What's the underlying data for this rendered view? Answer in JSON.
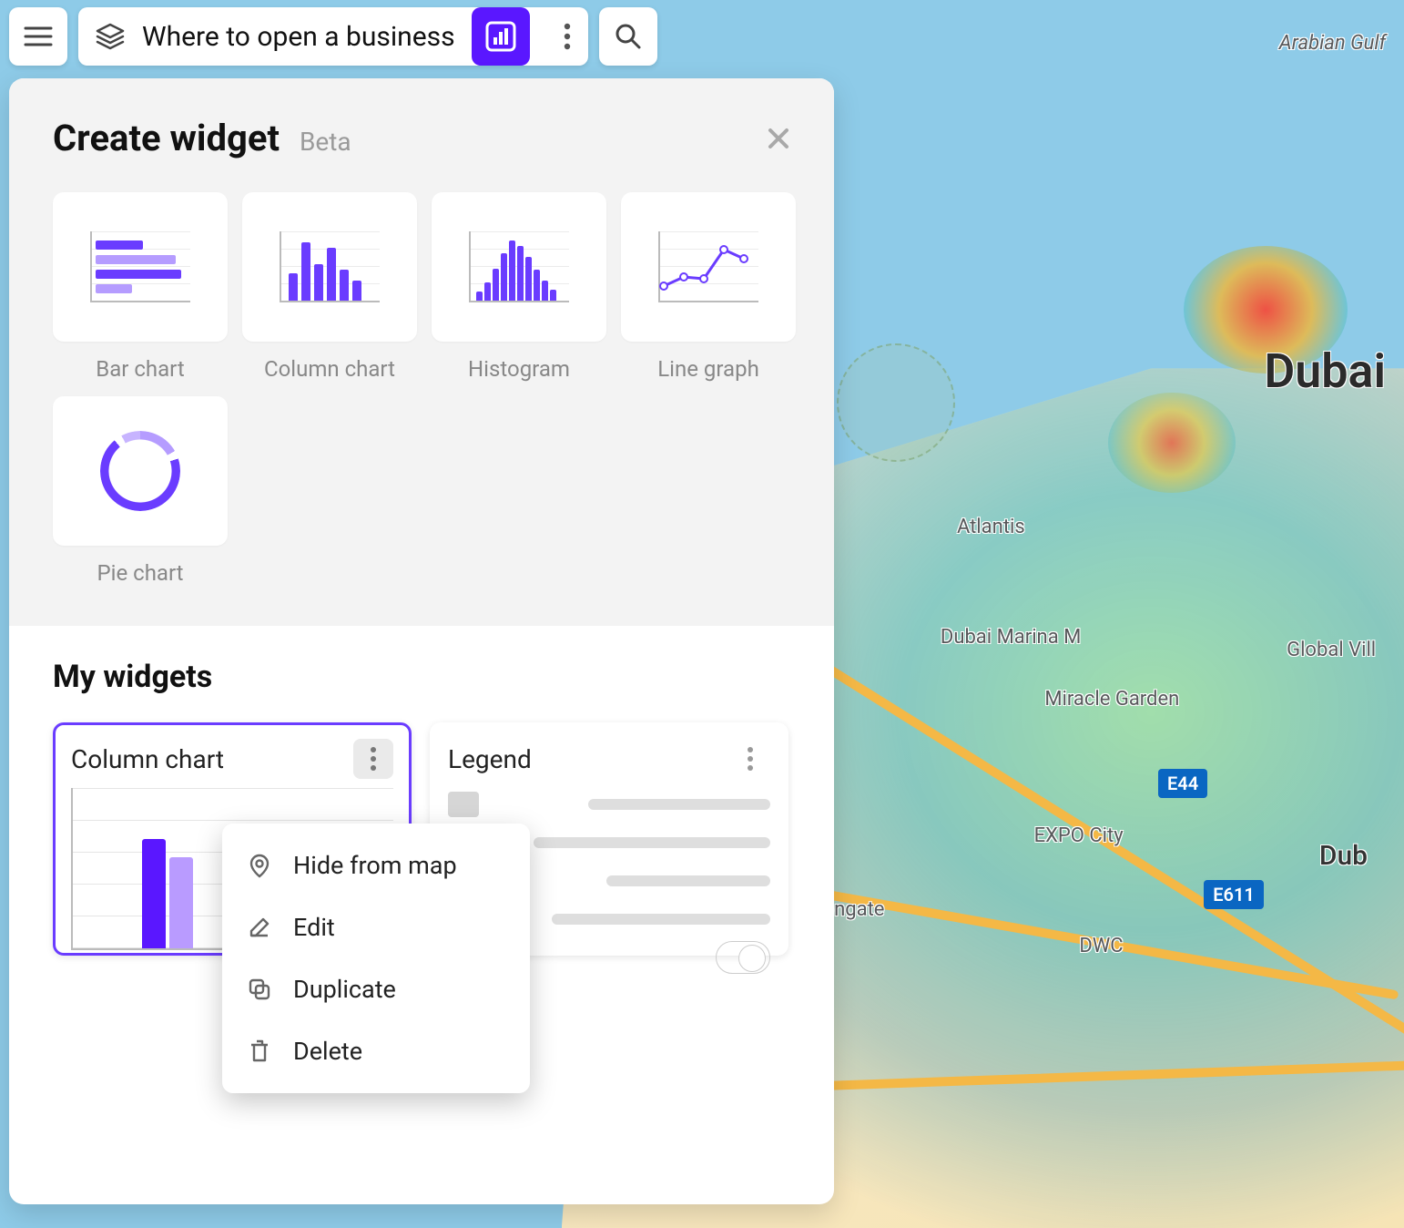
{
  "map": {
    "gulf_label": "Arabian Gulf",
    "dubai_big": "Dubai",
    "dubai_right": "Dub",
    "expo": "EXPO City",
    "dwc": "DWC",
    "atlantis": "Atlantis",
    "marina": "Dubai Marina M",
    "miracle": "Miracle Garden",
    "motion": "Motiongate",
    "global": "Global Vill",
    "road_tags": {
      "t1": "E44",
      "t2": "E611"
    }
  },
  "topbar": {
    "title": "Where to open a business"
  },
  "panel": {
    "create_title": "Create widget",
    "beta": "Beta",
    "options": [
      {
        "key": "bar",
        "label": "Bar chart"
      },
      {
        "key": "column",
        "label": "Column chart"
      },
      {
        "key": "histogram",
        "label": "Histogram"
      },
      {
        "key": "line",
        "label": "Line graph"
      },
      {
        "key": "pie",
        "label": "Pie chart"
      }
    ],
    "my_widgets_title": "My widgets",
    "widgets": [
      {
        "title": "Column chart"
      },
      {
        "title": "Legend"
      }
    ]
  },
  "context_menu": {
    "hide": "Hide from map",
    "edit": "Edit",
    "duplicate": "Duplicate",
    "delete": "Delete"
  },
  "colors": {
    "accent": "#5a17ff",
    "accent_light": "#b99bff"
  }
}
